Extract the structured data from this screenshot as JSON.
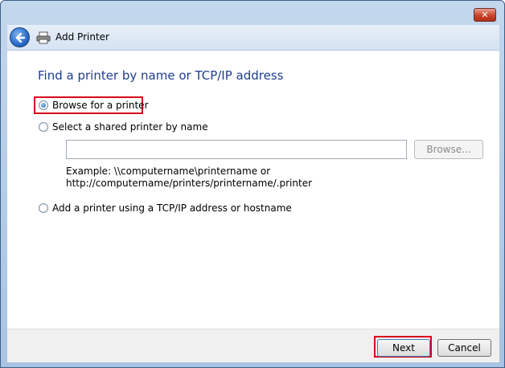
{
  "window": {
    "close_glyph": "✕"
  },
  "header": {
    "title": "Add Printer",
    "back_icon": "back-arrow-icon",
    "printer_icon": "printer-icon"
  },
  "main": {
    "heading": "Find a printer by name or TCP/IP address",
    "options": [
      {
        "label": "Browse for a printer",
        "checked": true
      },
      {
        "label": "Select a shared printer by name",
        "checked": false
      },
      {
        "label": "Add a printer using a TCP/IP address or hostname",
        "checked": false
      }
    ],
    "shared_input": {
      "value": "",
      "placeholder": ""
    },
    "browse_label": "Browse...",
    "example_line1": "Example: \\\\computername\\printername or",
    "example_line2": "http://computername/printers/printername/.printer"
  },
  "footer": {
    "next_label": "Next",
    "cancel_label": "Cancel"
  },
  "colors": {
    "accent": "#1e3e8c",
    "highlight": "#d9001b"
  }
}
